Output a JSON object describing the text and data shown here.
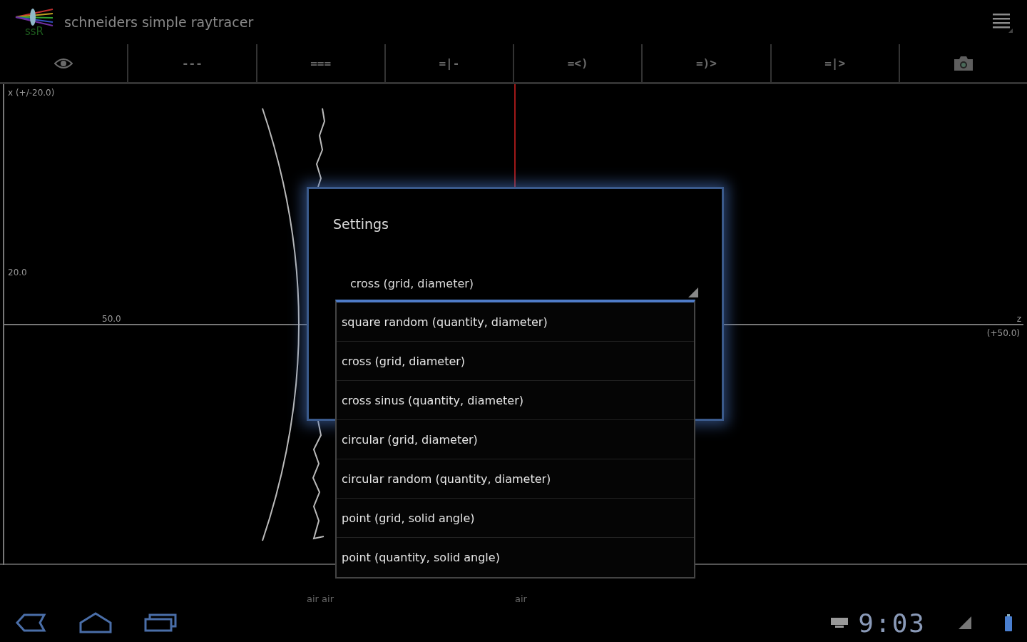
{
  "app_bar": {
    "logo_text": "ssR",
    "title": "schneiders simple raytracer"
  },
  "toolbar": [
    {
      "kind": "eye"
    },
    {
      "kind": "text",
      "label": "---"
    },
    {
      "kind": "text",
      "label": "==="
    },
    {
      "kind": "text",
      "label": "=|-"
    },
    {
      "kind": "text",
      "label": "=<)"
    },
    {
      "kind": "text",
      "label": "=)>"
    },
    {
      "kind": "text",
      "label": "=|>"
    },
    {
      "kind": "camera"
    }
  ],
  "canvas": {
    "y_axis_label": "x (+/-20.0)",
    "y_tick": "20.0",
    "x_tick": "50.0",
    "x_axis_label": "z",
    "x_range": "(+50.0)",
    "media_labels": [
      "air air",
      "air"
    ]
  },
  "dialog": {
    "title": "Settings",
    "spinner_value": "cross (grid, diameter)",
    "options": [
      "square random (quantity, diameter)",
      "cross (grid, diameter)",
      "cross sinus (quantity, diameter)",
      "circular (grid, diameter)",
      "circular random (quantity, diameter)",
      "point (grid, solid angle)",
      "point (quantity, solid angle)"
    ]
  },
  "status_bar": {
    "time": "9:03"
  }
}
